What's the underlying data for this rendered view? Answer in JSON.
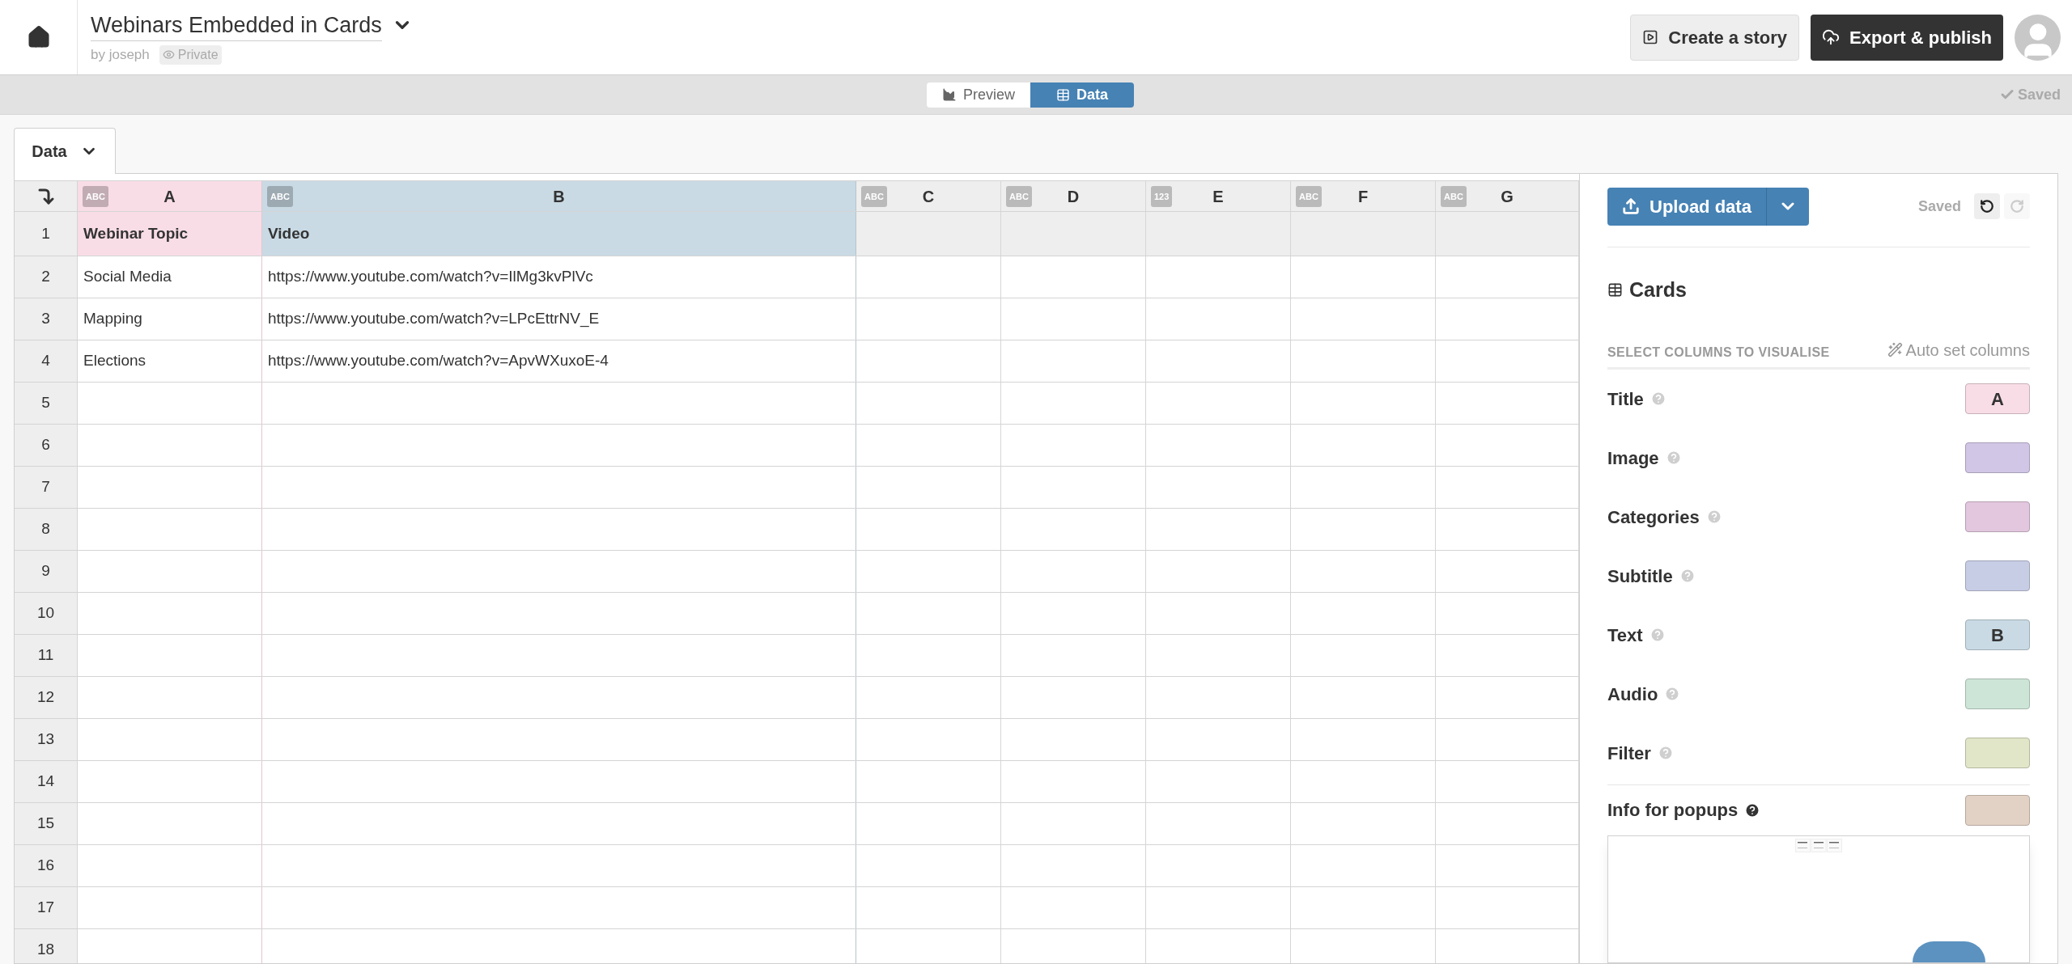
{
  "header": {
    "title": "Webinars Embedded in Cards",
    "author": "by joseph",
    "privacy": "Private",
    "buttons": [
      {
        "label": "Create a story",
        "kind": "story"
      },
      {
        "label": "Export & publish",
        "kind": "export"
      }
    ]
  },
  "toolbar": {
    "tabs": [
      {
        "label": "Preview",
        "kind": "preview",
        "selected": false
      },
      {
        "label": "Data",
        "kind": "data",
        "selected": true
      }
    ],
    "status": "Saved"
  },
  "sheet_tab": {
    "label": "Data"
  },
  "table": {
    "columns": [
      {
        "letter": "A",
        "type_label": "ABC",
        "color": "#f9dde6"
      },
      {
        "letter": "B",
        "type_label": "ABC",
        "color": "#c9dae4"
      },
      {
        "letter": "C",
        "type_label": "ABC",
        "color": "#eeeeee"
      },
      {
        "letter": "D",
        "type_label": "ABC",
        "color": "#eeeeee"
      },
      {
        "letter": "E",
        "type_label": "123",
        "color": "#eeeeee"
      },
      {
        "letter": "F",
        "type_label": "ABC",
        "color": "#eeeeee"
      },
      {
        "letter": "G",
        "type_label": "ABC",
        "color": "#eeeeee"
      }
    ],
    "rows": [
      {
        "number": "1",
        "kind": "header",
        "cells": [
          "Webinar Topic",
          "Video"
        ]
      },
      {
        "number": "2",
        "kind": "data",
        "cells": [
          "Social Media",
          "https://www.youtube.com/watch?v=IlMg3kvPlVc"
        ]
      },
      {
        "number": "3",
        "kind": "data",
        "cells": [
          "Mapping",
          "https://www.youtube.com/watch?v=LPcEttrNV_E"
        ]
      },
      {
        "number": "4",
        "kind": "data",
        "cells": [
          "Elections",
          "https://www.youtube.com/watch?v=ApvWXuxoE-4"
        ]
      },
      {
        "number": "5",
        "kind": "data"
      },
      {
        "number": "6",
        "kind": "data"
      },
      {
        "number": "7",
        "kind": "data"
      },
      {
        "number": "8",
        "kind": "data"
      },
      {
        "number": "9",
        "kind": "data"
      },
      {
        "number": "10",
        "kind": "data"
      },
      {
        "number": "11",
        "kind": "data"
      },
      {
        "number": "12",
        "kind": "data"
      },
      {
        "number": "13",
        "kind": "data"
      },
      {
        "number": "14",
        "kind": "data"
      },
      {
        "number": "15",
        "kind": "data"
      },
      {
        "number": "16",
        "kind": "data"
      },
      {
        "number": "17",
        "kind": "data"
      },
      {
        "number": "18",
        "kind": "data"
      }
    ]
  },
  "panel": {
    "upload_button": "Upload data",
    "status": "Saved",
    "undo": {
      "disabled": false
    },
    "redo": {
      "disabled": true
    },
    "heading": "Cards",
    "section_label": "SELECT COLUMNS TO VISUALISE",
    "auto_button": "Auto set columns",
    "fields": [
      {
        "label": "Title",
        "column": "A",
        "color": "#f9dde6",
        "help_active": false
      },
      {
        "label": "Image",
        "color": "#d1c6e6",
        "help_active": false
      },
      {
        "label": "Categories",
        "color": "#e2c7df",
        "help_active": false
      },
      {
        "label": "Subtitle",
        "color": "#c8cde6",
        "help_active": false
      },
      {
        "label": "Text",
        "column": "B",
        "color": "#c9dae4",
        "help_active": false
      },
      {
        "label": "Audio",
        "color": "#cde5d6",
        "help_active": false
      },
      {
        "label": "Filter",
        "color": "#e1e6c8",
        "help_active": false
      }
    ],
    "extra_fields": [
      {
        "label": "Info for popups",
        "color": "#e2d2c5",
        "help_active": true
      }
    ]
  }
}
